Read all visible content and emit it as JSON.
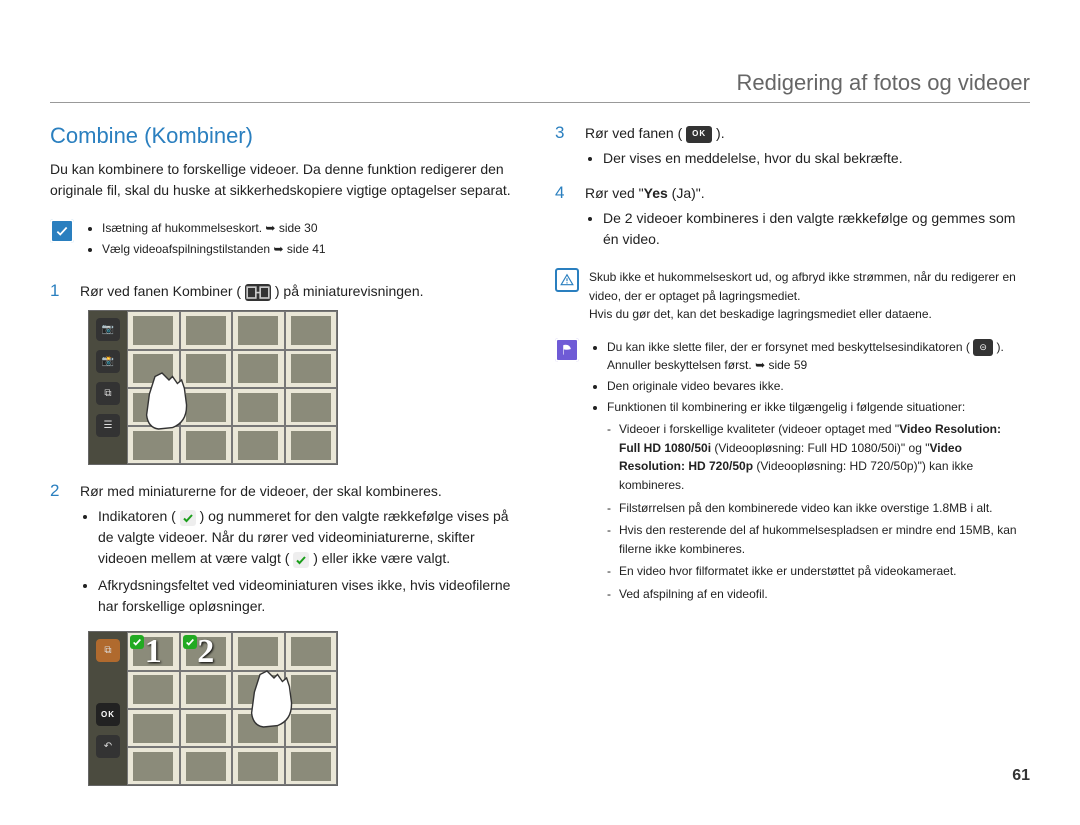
{
  "header": {
    "title": "Redigering af fotos og videoer"
  },
  "section": {
    "title": "Combine (Kombiner)"
  },
  "intro": "Du kan kombinere to forskellige videoer. Da denne funktion redigerer den originale fil, skal du huske at sikkerhedskopiere vigtige optagelser separat.",
  "prerequisites": {
    "items": [
      "Isætning af hukommelseskort.",
      "Vælg videoafspilningstilstanden"
    ],
    "page_refs": [
      "side 30",
      "side 41"
    ]
  },
  "steps": {
    "s1": {
      "num": "1",
      "text_before": "Rør ved fanen Kombiner (",
      "text_after": ") på miniaturevisningen."
    },
    "s2": {
      "num": "2",
      "text": "Rør med miniaturerne for de videoer, der skal kombineres.",
      "bullets": [
        {
          "a": "Indikatoren (",
          "b": ") og nummeret for den valgte rækkefølge vises på de valgte videoer. Når du rører ved videominiaturerne, skifter videoen mellem at være valgt (",
          "c": ") eller ikke være valgt."
        },
        {
          "single": "Afkrydsningsfeltet ved videominiaturen vises ikke, hvis videofilerne har forskellige opløsninger."
        }
      ]
    },
    "s3": {
      "num": "3",
      "text_before": "Rør ved fanen (",
      "text_after": ").",
      "bullet": "Der vises en meddelelse, hvor du skal bekræfte."
    },
    "s4": {
      "num": "4",
      "text_before": "Rør ved \"",
      "yes_bold": "Yes",
      "text_after": " (Ja)\".",
      "bullet": "De 2 videoer kombineres i den valgte rækkefølge og gemmes som én video."
    }
  },
  "warning": {
    "line1": "Skub ikke et hukommelseskort ud, og afbryd ikke strømmen, når du redigerer en video, der er optaget på lagringsmediet.",
    "line2": "Hvis du gør det, kan det beskadige lagringsmediet eller dataene."
  },
  "notes": {
    "items": [
      {
        "before": "Du kan ikke slette filer, der er forsynet med beskyttelsesindikatoren (",
        "after": "). Annuller beskyttelsen først. ",
        "page_ref": "side 59"
      },
      {
        "single": "Den originale video bevares ikke."
      },
      {
        "single": "Funktionen til kombinering er ikke tilgængelig i følgende situationer:"
      }
    ],
    "sublist": [
      {
        "a": "Videoer i forskellige kvaliteter (videoer optaget med \"",
        "b1": "Video Resolution: Full HD  1080/50i",
        "c": " (Videoopløsning: Full HD  1080/50i)\" og \"",
        "b2": "Video Resolution: HD  720/50p",
        "d": " (Videoopløsning: HD 720/50p)\") kan ikke kombineres."
      },
      {
        "single": "Filstørrelsen på den kombinerede video kan ikke overstige 1.8MB i alt."
      },
      {
        "single": "Hvis den resterende del af hukommelsespladsen er mindre end 15MB, kan filerne ikke kombineres."
      },
      {
        "single": "En video hvor filformatet ikke er understøttet på videokameraet."
      },
      {
        "single": "Ved afspilning af en videofil."
      }
    ]
  },
  "ui_labels": {
    "ok": "OK",
    "key_icon_alt": "key",
    "combine_icon_alt": "combine"
  },
  "page_number": "61"
}
